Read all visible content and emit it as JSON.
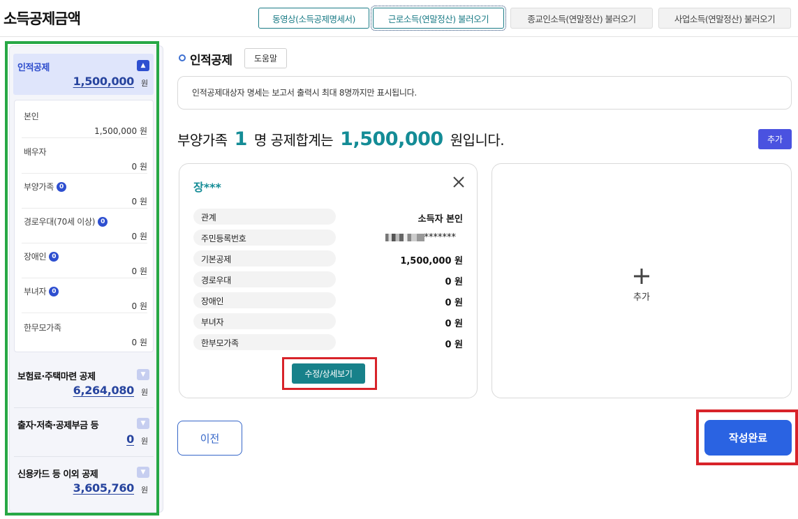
{
  "header": {
    "title": "소득공제금액",
    "buttons": [
      "동영상(소득공제명세서)",
      "근로소득(연말정산) 불러오기",
      "종교인소득(연말정산) 불러오기",
      "사업소득(연말정산) 불러오기"
    ]
  },
  "sidebar": {
    "unit": "원",
    "active": {
      "title": "인적공제",
      "amount": "1,500,000",
      "expanded": true
    },
    "sub_items": [
      {
        "label": "본인",
        "value": "1,500,000 원"
      },
      {
        "label": "배우자",
        "value": "0 원"
      },
      {
        "label": "부양가족",
        "badge": "0",
        "value": "0 원"
      },
      {
        "label": "경로우대(70세 이상)",
        "badge": "0",
        "value": "0 원"
      },
      {
        "label": "장애인",
        "badge": "0",
        "value": "0 원"
      },
      {
        "label": "부녀자",
        "badge": "0",
        "value": "0 원"
      },
      {
        "label": "한무모가족",
        "value": "0 원"
      }
    ],
    "sections": [
      {
        "title": "보험료·주택마련 공제",
        "amount": "6,264,080"
      },
      {
        "title": "출자·저축·공제부금 등",
        "amount": "0"
      },
      {
        "title": "신용카드 등 이외 공제",
        "amount": "3,605,760"
      }
    ]
  },
  "main": {
    "section_title": "인적공제",
    "help_label": "도움말",
    "notice": "인적공제대상자 명세는 보고서 출력시 최대 8명까지만 표시됩니다.",
    "summary": {
      "prefix": "부양가족",
      "count": "1",
      "mid": "명 공제합계는",
      "total": "1,500,000",
      "suffix": "원입니다."
    },
    "add_label": "추가",
    "card": {
      "name": "장***",
      "rows": [
        {
          "label": "관계",
          "value": "소득자 본인"
        },
        {
          "label": "주민등록번호",
          "value": "*******"
        },
        {
          "label": "기본공제",
          "value": "1,500,000  원"
        },
        {
          "label": "경로우대",
          "value": "0  원"
        },
        {
          "label": "장애인",
          "value": "0  원"
        },
        {
          "label": "부녀자",
          "value": "0  원"
        },
        {
          "label": "한부모가족",
          "value": "0  원"
        }
      ],
      "edit_label": "수정/상세보기"
    },
    "add_card_label": "추가",
    "prev_label": "이전",
    "done_label": "작성완료"
  },
  "colors": {
    "teal": "#148c96",
    "brand_blue": "#2a63e2",
    "sidebar_blue": "#27449e",
    "highlight_red": "#d8232a",
    "highlight_green": "#27a845"
  }
}
